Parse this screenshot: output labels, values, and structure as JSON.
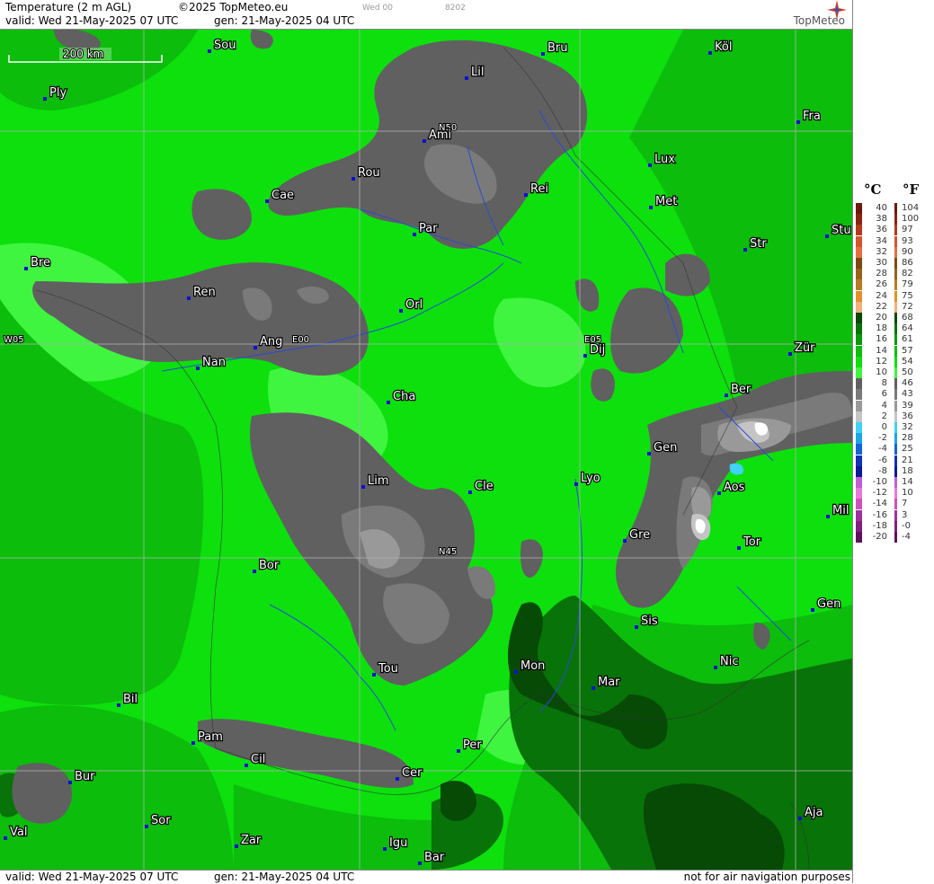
{
  "header": {
    "title": "Temperature (2 m AGL)",
    "copyright": "©2025 TopMeteo.eu",
    "valid": "valid:  Wed  21-May-2025  07 UTC",
    "generated": "gen:  21-May-2025  04 UTC",
    "small_a": "Wed 00",
    "small_b": "8202",
    "logo": "TopMeteo"
  },
  "footer": {
    "valid": "valid:  Wed  21-May-2025  07 UTC",
    "generated": "gen:  21-May-2025  04 UTC",
    "disclaimer": "not for air navigation purposes"
  },
  "map": {
    "scale": "200 km",
    "grid_labels": [
      "N50",
      "N45",
      "W05",
      "E00",
      "E05"
    ],
    "cities": [
      "Sou",
      "Bru",
      "Köl",
      "Lil",
      "Ply",
      "Ami",
      "Fra",
      "Lux",
      "Rou",
      "Rei",
      "Cae",
      "Met",
      "Par",
      "Stu",
      "Str",
      "Bre",
      "Ren",
      "Orl",
      "Ang",
      "Nan",
      "Dij",
      "Zür",
      "Cha",
      "Ber",
      "Gen",
      "Lim",
      "Cle",
      "Lyo",
      "Aos",
      "Mil",
      "Gre",
      "Tor",
      "Bor",
      "Sis",
      "Gen",
      "Nic",
      "Tou",
      "Mon",
      "Mar",
      "Bil",
      "Pam",
      "Cil",
      "Per",
      "Cer",
      "Bur",
      "Aja",
      "Sor",
      "Val",
      "Zar",
      "Igu",
      "Bar"
    ]
  },
  "legend": {
    "celsius_unit": "°C",
    "fahrenheit_unit": "°F",
    "rows": [
      {
        "c": "40",
        "f": "104",
        "color": "#6b1a0d"
      },
      {
        "c": "38",
        "f": "100",
        "color": "#8a2412"
      },
      {
        "c": "36",
        "f": "97",
        "color": "#b33a1c"
      },
      {
        "c": "34",
        "f": "93",
        "color": "#d4552a"
      },
      {
        "c": "32",
        "f": "90",
        "color": "#e86f3d"
      },
      {
        "c": "30",
        "f": "86",
        "color": "#7a4a12"
      },
      {
        "c": "28",
        "f": "82",
        "color": "#99611a"
      },
      {
        "c": "26",
        "f": "79",
        "color": "#b97a22"
      },
      {
        "c": "24",
        "f": "75",
        "color": "#e3902a"
      },
      {
        "c": "22",
        "f": "72",
        "color": "#f2b07a"
      },
      {
        "c": "20",
        "f": "68",
        "color": "#064a06"
      },
      {
        "c": "18",
        "f": "64",
        "color": "#087308"
      },
      {
        "c": "16",
        "f": "61",
        "color": "#0a9a0a"
      },
      {
        "c": "14",
        "f": "57",
        "color": "#0cbd0c"
      },
      {
        "c": "12",
        "f": "54",
        "color": "#0de00d"
      },
      {
        "c": "10",
        "f": "50",
        "color": "#3ff53f"
      },
      {
        "c": "8",
        "f": "46",
        "color": "#606060"
      },
      {
        "c": "6",
        "f": "43",
        "color": "#7a7a7a"
      },
      {
        "c": "4",
        "f": "39",
        "color": "#999999"
      },
      {
        "c": "2",
        "f": "36",
        "color": "#c4c4c4"
      },
      {
        "c": "0",
        "f": "32",
        "color": "#3fd3f5"
      },
      {
        "c": "-2",
        "f": "28",
        "color": "#1aa6e8"
      },
      {
        "c": "-4",
        "f": "25",
        "color": "#1464d6"
      },
      {
        "c": "-6",
        "f": "21",
        "color": "#1033b8"
      },
      {
        "c": "-8",
        "f": "18",
        "color": "#0a1a99"
      },
      {
        "c": "-10",
        "f": "14",
        "color": "#c060d8"
      },
      {
        "c": "-12",
        "f": "10",
        "color": "#e87ad8"
      },
      {
        "c": "-14",
        "f": "7",
        "color": "#d050c0"
      },
      {
        "c": "-16",
        "f": "3",
        "color": "#a030a0"
      },
      {
        "c": "-18",
        "f": "-0",
        "color": "#802080"
      },
      {
        "c": "-20",
        "f": "-4",
        "color": "#601060"
      }
    ]
  }
}
